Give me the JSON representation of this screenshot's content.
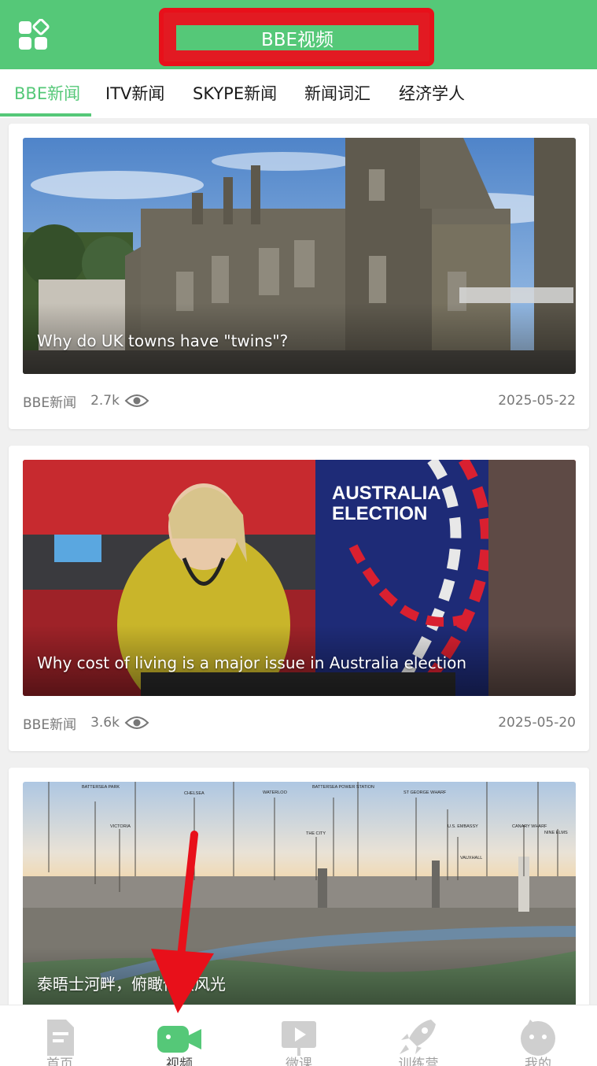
{
  "header": {
    "title": "BBE视频"
  },
  "tabs": [
    {
      "label": "BBE新闻",
      "active": true
    },
    {
      "label": "ITV新闻",
      "active": false
    },
    {
      "label": "SKYPE新闻",
      "active": false
    },
    {
      "label": "新闻词汇",
      "active": false
    },
    {
      "label": "经济学人",
      "active": false
    }
  ],
  "videos": [
    {
      "caption": "Why do UK towns have \"twins\"?",
      "source": "BBE新闻",
      "views": "2.7k",
      "date": "2025-05-22",
      "thumbnail": "town-hall-photo"
    },
    {
      "caption": "Why cost of living is a major issue in Australia election",
      "source": "BBE新闻",
      "views": "3.6k",
      "date": "2025-05-20",
      "thumbnail": "news-anchor-photo",
      "thumbnail_text": [
        "AUSTRALIA",
        "ELECTION"
      ]
    },
    {
      "caption": "泰晤士河畔，俯瞰伦敦风光",
      "thumbnail": "london-skyline-photo",
      "thumbnail_labels": [
        "BATTERSEA PARK",
        "VICTORIA",
        "CHELSEA",
        "WATERLOO",
        "BATTERSEA POWER STATION",
        "THE CITY",
        "ST GEORGE WHARF",
        "U.S. EMBASSY",
        "VAUXHALL",
        "CANARY WHARF",
        "NINE ELMS"
      ]
    }
  ],
  "bottom_nav": [
    {
      "label": "首页",
      "icon": "document-icon",
      "active": false
    },
    {
      "label": "视频",
      "icon": "video-camera-icon",
      "active": true
    },
    {
      "label": "微课",
      "icon": "play-board-icon",
      "active": false
    },
    {
      "label": "训练营",
      "icon": "rocket-icon",
      "active": false
    },
    {
      "label": "我的",
      "icon": "face-icon",
      "active": false
    }
  ],
  "colors": {
    "brand_green": "#55c878",
    "highlight_red": "#e21a22",
    "text_gray": "#777777"
  }
}
